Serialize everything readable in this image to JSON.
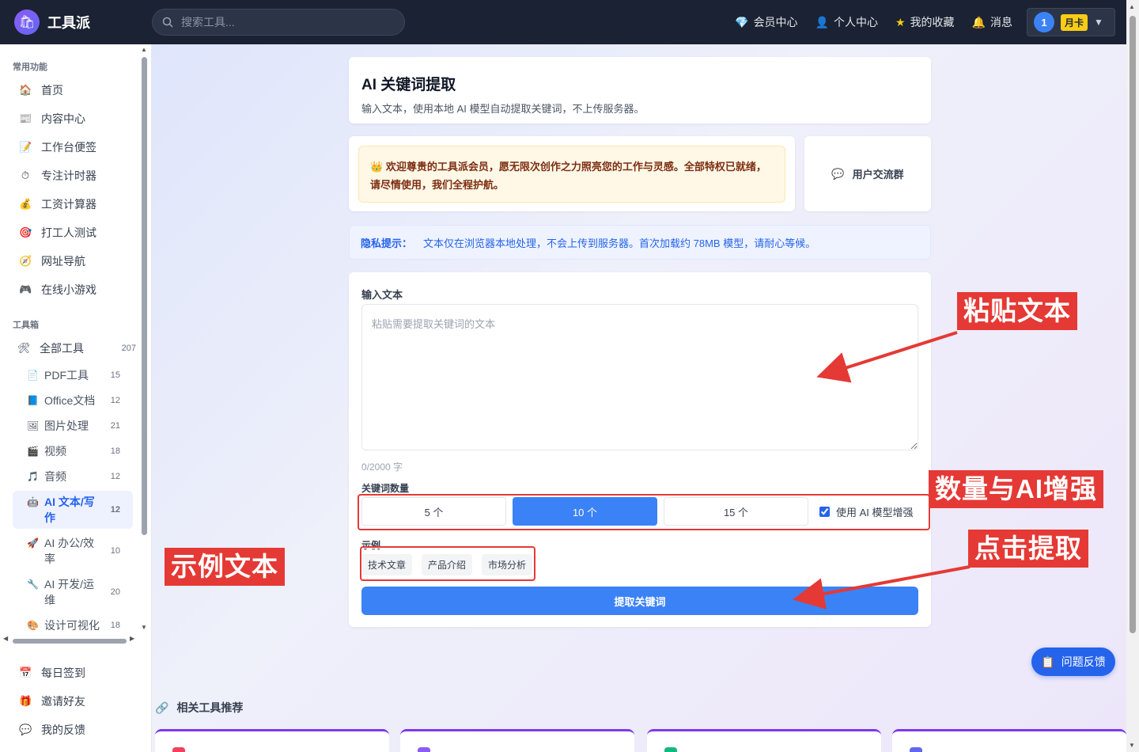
{
  "topbar": {
    "logo_text": "工具派",
    "search_placeholder": "搜索工具...",
    "nav": [
      {
        "icon": "diamond-icon",
        "label": "会员中心"
      },
      {
        "icon": "person-icon",
        "label": "个人中心"
      },
      {
        "icon": "star-icon",
        "label": "我的收藏"
      },
      {
        "icon": "bell-icon",
        "label": "消息"
      }
    ],
    "user_avatar": "1",
    "user_badge": "月卡"
  },
  "sidebar": {
    "section_common": "常用功能",
    "common_items": [
      {
        "icon": "🏠",
        "label": "首页"
      },
      {
        "icon": "📰",
        "label": "内容中心"
      },
      {
        "icon": "📝",
        "label": "工作台便签"
      },
      {
        "icon": "⏱",
        "label": "专注计时器"
      },
      {
        "icon": "💰",
        "label": "工资计算器"
      },
      {
        "icon": "🎯",
        "label": "打工人测试"
      },
      {
        "icon": "🧭",
        "label": "网址导航"
      },
      {
        "icon": "🎮",
        "label": "在线小游戏"
      }
    ],
    "section_tools": "工具箱",
    "all_tools": {
      "icon": "🛠",
      "label": "全部工具",
      "count": "207"
    },
    "tool_items": [
      {
        "icon": "📄",
        "label": "PDF工具",
        "count": "15"
      },
      {
        "icon": "📘",
        "label": "Office文档",
        "count": "12"
      },
      {
        "icon": "🖼",
        "label": "图片处理",
        "count": "21"
      },
      {
        "icon": "🎬",
        "label": "视频",
        "count": "18"
      },
      {
        "icon": "🎵",
        "label": "音频",
        "count": "12"
      },
      {
        "icon": "🤖",
        "label": "AI 文本/写作",
        "count": "12",
        "active": true
      },
      {
        "icon": "🚀",
        "label": "AI 办公/效率",
        "count": "10"
      },
      {
        "icon": "🔧",
        "label": "AI 开发/运维",
        "count": "20"
      },
      {
        "icon": "🎨",
        "label": "设计可视化",
        "count": "18"
      }
    ],
    "bottom_items": [
      {
        "icon": "📅",
        "label": "每日签到"
      },
      {
        "icon": "🎁",
        "label": "邀请好友"
      },
      {
        "icon": "💬",
        "label": "我的反馈"
      }
    ]
  },
  "main": {
    "title": "AI 关键词提取",
    "subtitle": "输入文本，使用本地 AI 模型自动提取关键词，不上传服务器。",
    "welcome_icon": "👑",
    "welcome_text": "欢迎尊贵的工具派会员，愿无限次创作之力照亮您的工作与灵感。全部特权已就绪，请尽情使用，我们全程护航。",
    "group_label": "用户交流群",
    "privacy_label": "隐私提示：",
    "privacy_text": "文本仅在浏览器本地处理，不会上传到服务器。首次加载约 78MB 模型，请耐心等候。",
    "input_label": "输入文本",
    "input_placeholder": "粘贴需要提取关键词的文本",
    "counter": "0/2000 字",
    "count_label": "关键词数量",
    "count_options": [
      "5 个",
      "10 个",
      "15 个"
    ],
    "count_selected": "10 个",
    "ai_enhance_label": "使用 AI 模型增强",
    "ai_enhance_checked": true,
    "example_label": "示例",
    "examples": [
      "技术文章",
      "产品介绍",
      "市场分析"
    ],
    "extract_button": "提取关键词",
    "related_title": "相关工具推荐"
  },
  "annotations": [
    "粘贴文本",
    "数量与AI增强",
    "示例文本",
    "点击提取"
  ],
  "feedback_button": "问题反馈",
  "colors": {
    "primary": "#3b82f6",
    "annotation": "#e53935",
    "topbar": "#1a2233"
  }
}
